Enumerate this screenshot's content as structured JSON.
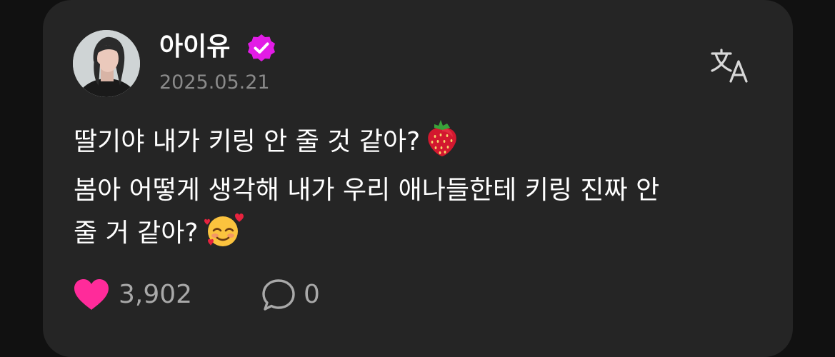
{
  "post": {
    "author": "아이유",
    "verified_icon": "verified-badge-icon",
    "date": "2025.05.21",
    "translate_icon": "translate-icon",
    "lines": [
      "딸기야 내가 키링 안 줄 것 같아?",
      "봄아 어떻게 생각해 내가 우리 애나들한테 키링 진짜 안",
      "줄 거 같아?"
    ],
    "emojis": [
      "strawberry",
      "smiling-face-with-hearts"
    ]
  },
  "actions": {
    "like_icon": "heart-icon",
    "like_count": "3,902",
    "comment_icon": "comment-icon",
    "comment_count": "0"
  },
  "colors": {
    "background": "#111111",
    "card": "#252525",
    "accent_verified": "#e21ce6",
    "like": "#ff2b9a",
    "muted_text": "#8a8a8a"
  }
}
